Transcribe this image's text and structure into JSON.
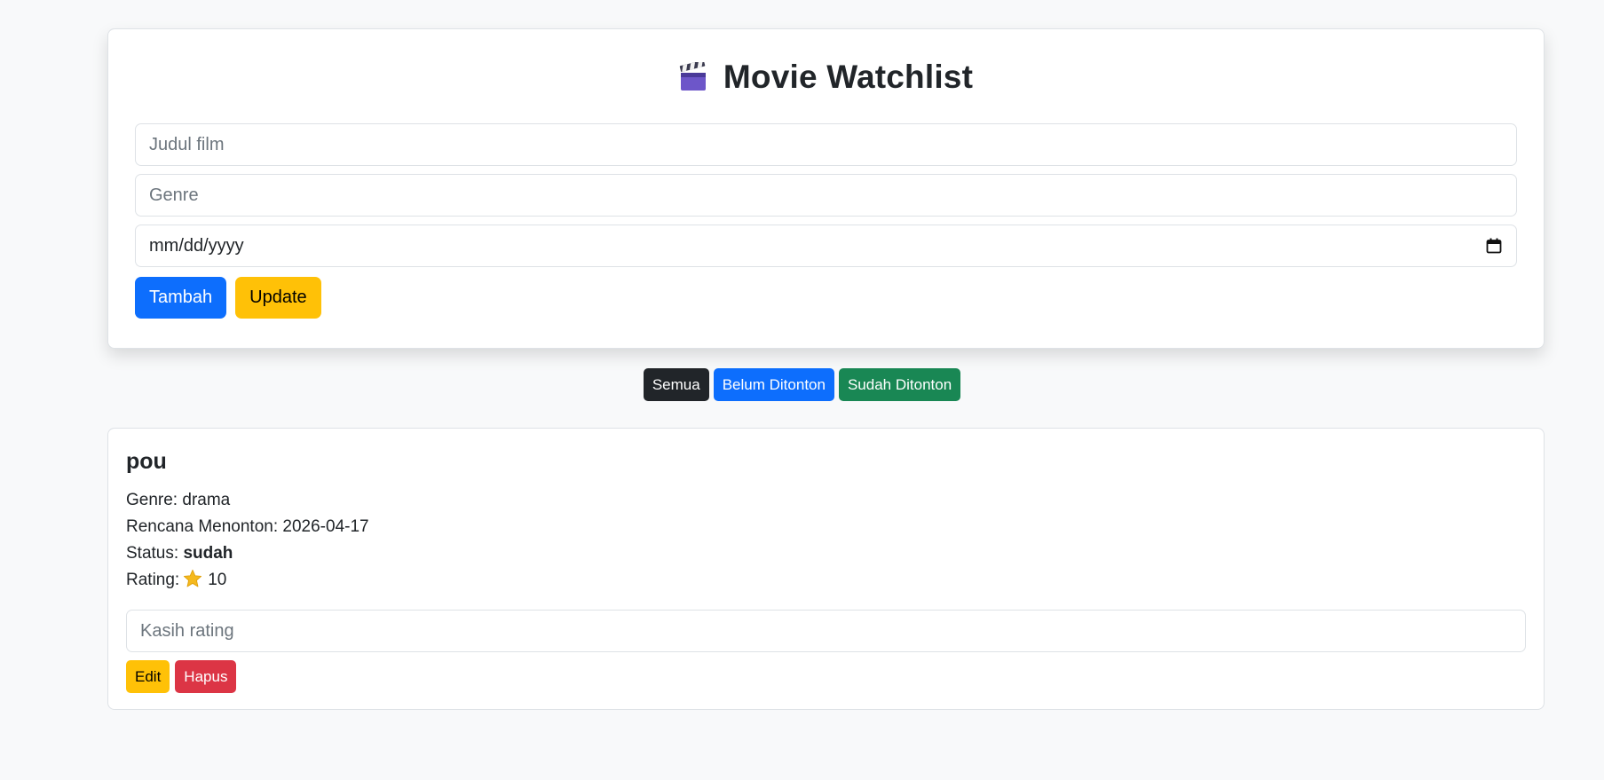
{
  "header": {
    "icon": "clapperboard-icon",
    "title": "Movie Watchlist"
  },
  "form": {
    "title_placeholder": "Judul film",
    "genre_placeholder": "Genre",
    "date_placeholder": "mm/dd/yyyy",
    "add_label": "Tambah",
    "update_label": "Update"
  },
  "filters": {
    "all": "Semua",
    "unwatched": "Belum Ditonton",
    "watched": "Sudah Ditonton"
  },
  "movie": {
    "title": "pou",
    "genre_label": "Genre:",
    "genre": "drama",
    "plan_label": "Rencana Menonton:",
    "plan_date": "2026-04-17",
    "status_label": "Status:",
    "status": "sudah",
    "rating_label": "Rating:",
    "rating_icon": "star-icon",
    "rating": "10",
    "rating_placeholder": "Kasih rating",
    "edit_label": "Edit",
    "delete_label": "Hapus"
  },
  "colors": {
    "primary": "#0d6efd",
    "warning": "#ffc107",
    "dark": "#212529",
    "success": "#198754",
    "danger": "#dc3545",
    "background": "#f8f9fa"
  }
}
